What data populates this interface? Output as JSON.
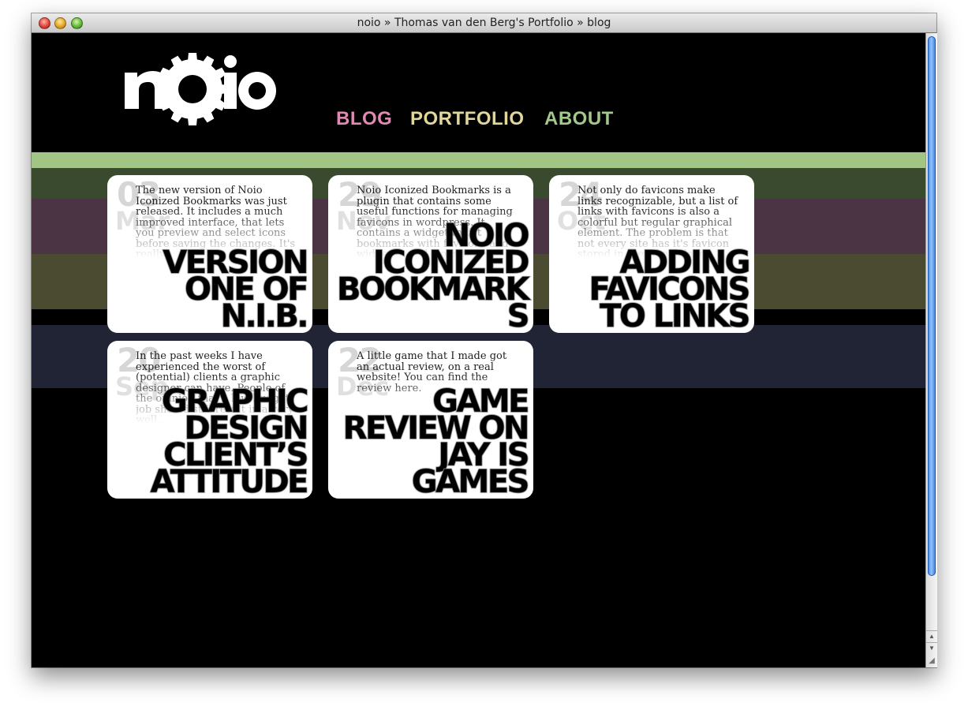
{
  "window": {
    "title": "noio » Thomas van den Berg's Portfolio » blog"
  },
  "site": {
    "logo_text": "noio",
    "colors": {
      "blog": "#e089b3",
      "portfolio": "#e2d79b",
      "about": "#a2c98a",
      "stripe_green": "#a2c585",
      "stripe_olive": "#3a4a2e",
      "stripe_maroon": "#4b3443",
      "stripe_tan": "#4b4b31",
      "stripe_navy": "#212434"
    }
  },
  "nav": {
    "items": [
      {
        "label": "BLOG"
      },
      {
        "label": "PORTFOLIO"
      },
      {
        "label": "ABOUT"
      }
    ]
  },
  "posts": [
    {
      "day": "03",
      "month": "Mar",
      "excerpt": "The new version of Noio Iconized Bookmarks was just released. It includes a much improved interface, that lets you preview and select icons before saving the changes. It's really...",
      "title": "VERSION ONE OF N.I.B."
    },
    {
      "day": "29",
      "month": "Nov",
      "excerpt": "Noio Iconized Bookmarks is a plugin that contains some useful functions for managing favicons in wordpress. It contains a widget to list bookmarks with favicons and a widget to add icons to...",
      "title": "NOIO ICONIZED BOOKMARKS"
    },
    {
      "day": "24",
      "month": "Oct",
      "excerpt": "Not only do favicons make links recognizable, but a list of links with favicons is also a colorful but regular graphical element. The problem is that not every site has it's favicon stored in the same place.",
      "title": "ADDING FAVICONS TO LINKS"
    },
    {
      "day": "20",
      "month": "Sep",
      "excerpt": "In the past weeks I have experienced the worst of (potential) clients a graphic designer can have. People of the opinion that a low-budget job should still result in a very well...",
      "title": "GRAPHIC DESIGN CLIENT’S ATTITUDE"
    },
    {
      "day": "22",
      "month": "Dec",
      "excerpt": "A little game that I made got an actual review, on a real website! You can find the review here.",
      "title": "GAME REVIEW ON JAY IS GAMES"
    }
  ]
}
